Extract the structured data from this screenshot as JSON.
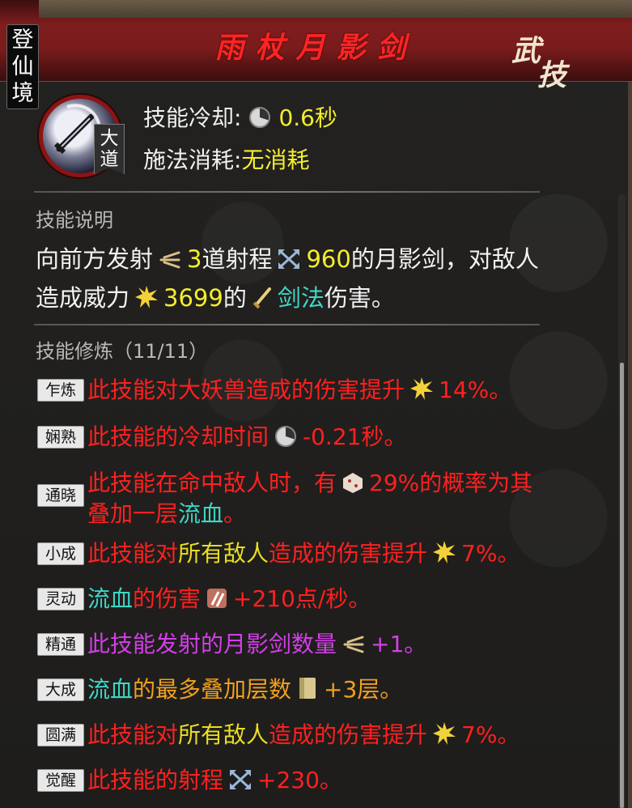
{
  "realm_label": "登仙境",
  "title": "雨杖月影剑",
  "badge": "武技",
  "skill_rank_badge": "大道",
  "stats": {
    "cooldown_label": "技能冷却:",
    "cooldown_value": "0.6秒",
    "cost_label": "施法消耗:",
    "cost_value": "无消耗"
  },
  "description": {
    "heading": "技能说明",
    "p1": "向前方发射",
    "count": "3",
    "p2": "道射程",
    "range": "960",
    "p3": "的月影剑，对敌人",
    "p4": "造成威力",
    "power": "3699",
    "p5": "的",
    "type": "剑法",
    "p6": "伤害。"
  },
  "cultivation": {
    "heading": "技能修炼（11/11）",
    "rows": [
      {
        "tag": "乍炼",
        "a": "此技能对大妖兽造成的伤害提升",
        "b": "14%。",
        "icon": "burst-icon"
      },
      {
        "tag": "娴熟",
        "a": "此技能的冷却时间",
        "b": "-0.21秒。",
        "icon": "cooldown-icon"
      },
      {
        "tag": "通晓",
        "a": "此技能在命中敌人时，有",
        "b": "29%的概率为其",
        "c": "叠加一层",
        "d": "流血",
        "e": "。",
        "icon": "dice-icon"
      },
      {
        "tag": "小成",
        "a": "此技能对",
        "b": "所有敌人",
        "c": "造成的伤害提升",
        "d": "7%。",
        "icon": "burst-icon"
      },
      {
        "tag": "灵动",
        "a": "流血",
        "b": "的伤害",
        "c": "+210点/秒。",
        "icon": "bleed-icon"
      },
      {
        "tag": "精通",
        "a": "此技能发射的月影剑数量",
        "b": "+1。",
        "icon": "projectile-icon"
      },
      {
        "tag": "大成",
        "a": "流血",
        "b": "的最多叠加层数",
        "c": "+3层。",
        "icon": "scroll-icon"
      },
      {
        "tag": "圆满",
        "a": "此技能对",
        "b": "所有敌人",
        "c": "造成的伤害提升",
        "d": "7%。",
        "icon": "burst-icon"
      },
      {
        "tag": "觉醒",
        "a": "此技能的射程",
        "b": "+230。",
        "icon": "range-icon"
      }
    ]
  },
  "colors": {
    "red": "#ff2020",
    "yellow": "#f4ee2e",
    "cyan": "#3ed6c6",
    "purple": "#d33ee8",
    "header": "#7e1d1d"
  }
}
